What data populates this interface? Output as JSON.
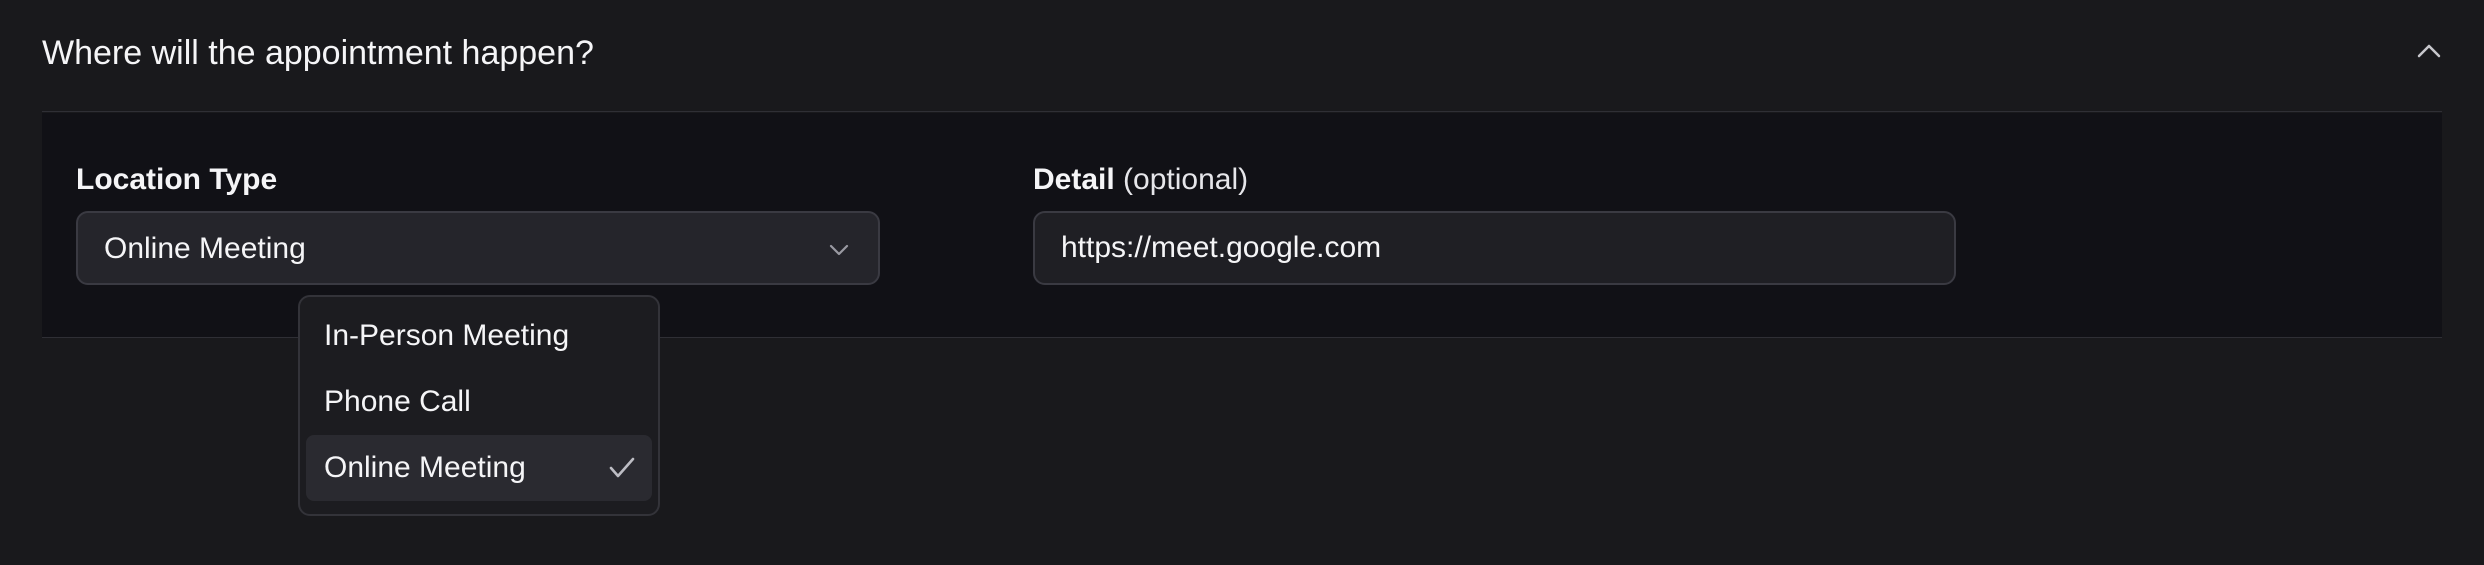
{
  "section": {
    "title": "Where will the appointment happen?"
  },
  "location_type": {
    "label": "Location Type",
    "selected_value": "Online Meeting",
    "options": [
      {
        "label": "In-Person Meeting",
        "selected": false
      },
      {
        "label": "Phone Call",
        "selected": false
      },
      {
        "label": "Online Meeting",
        "selected": true
      }
    ]
  },
  "detail": {
    "label": "Detail",
    "optional_text": "(optional)",
    "value": "https://meet.google.com"
  },
  "icons": {
    "collapse": "chevron-up-icon",
    "select": "chevron-down-icon",
    "selected_option": "check-icon"
  },
  "colors": {
    "background": "#19191c",
    "panel": "#111116",
    "input_background": "#25252b",
    "border": "#3a3a42",
    "text": "#f5f5f7"
  }
}
